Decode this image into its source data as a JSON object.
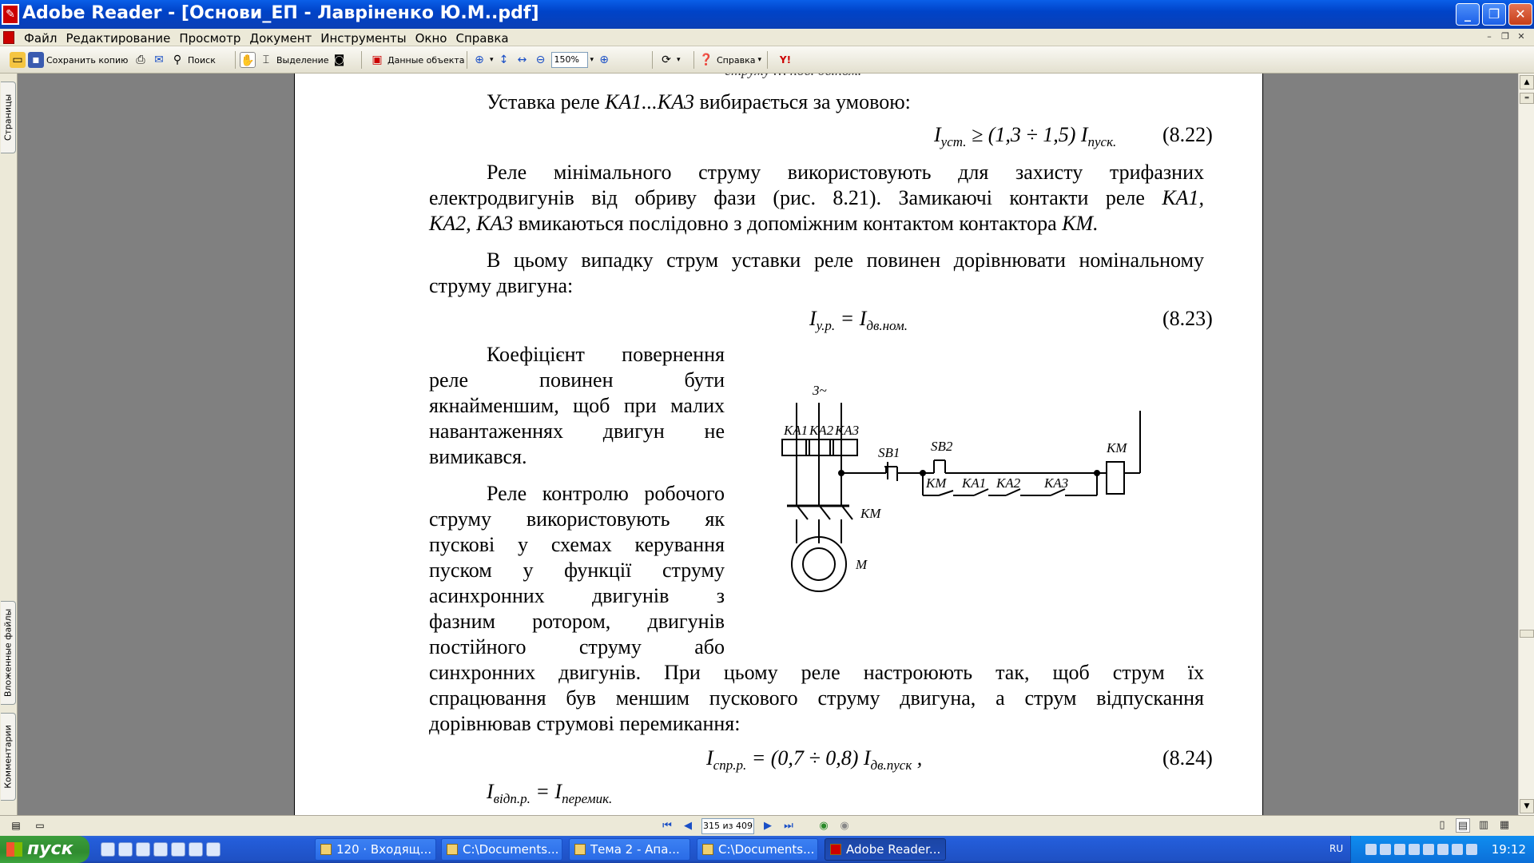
{
  "window": {
    "title": "Adobe Reader - [Основи_ЕП - Лавріненко Ю.М..pdf]",
    "controls": [
      "minimize",
      "restore",
      "close"
    ]
  },
  "menu": {
    "items": [
      "Файл",
      "Редактирование",
      "Просмотр",
      "Документ",
      "Инструменты",
      "Окно",
      "Справка"
    ]
  },
  "toolbar": {
    "save_copy": "Сохранить копию",
    "search": "Поиск",
    "select": "Выделение",
    "data_objects": "Данные объекта",
    "zoom": "150%",
    "help": "Справка"
  },
  "side_tabs": {
    "pages": "Страницы",
    "attachments": "Вложенные файлы",
    "comments": "Комментарии"
  },
  "document": {
    "top_line": "струму … пов.   дв.ном.",
    "p1": "Уставка реле",
    "p1_italic": "КА1...КА3",
    "p1_end": "вибирається за умовою:",
    "f822": {
      "lhs": "I",
      "lhs_sub": "уст.",
      "expr": " ≥ (1,3 ÷ 1,5) I",
      "rhs_sub": "пуск.",
      "num": "(8.22)"
    },
    "p2_line1": "Реле мінімального струму використовують для захисту трифазних",
    "p2_line2a": "електродвигунів від обриву фази  (рис. 8.21). Замикаючі контакти реле",
    "p2_line2b": "КА1,",
    "p2_line3a": "КА2, КА3",
    "p2_line3b": "вмикаються послідовно з допоміжним контактом контактора",
    "p2_line3c": "КМ.",
    "p3_line1": "В цьому випадку струм уставки реле повинен дорівнювати номінальному",
    "p3_line2": "струму двигуна:",
    "f823": {
      "lhs": "I",
      "lhs_sub": "у.р.",
      "eq": " = I",
      "rhs_sub": "дв.ном.",
      "num": "(8.23)"
    },
    "p4": [
      "Коефіцієнт повернення",
      "реле повинен бути",
      "якнайменшим, щоб при малих",
      "навантаженнях двигун не",
      "вимикався."
    ],
    "p5": [
      "Реле контролю робочого",
      "струму використовують як",
      "пускові у схемах керування",
      "пуском у функції струму",
      "асинхронних двигунів з",
      "фазним ротором, двигунів",
      "постійного струму або"
    ],
    "p5_line8": "синхронних двигунів. При цьому реле настроюють так, щоб струм їх",
    "p5_line9": "спрацювання був меншим пускового струму двигуна, а струм відпускання",
    "p5_line10": "дорівнював струмові перемикання:",
    "f824": {
      "lhs": "I",
      "lhs_sub": "спр.р.",
      "expr": " = (0,7 ÷ 0,8) I",
      "rhs_sub": "дв.пуск",
      "tail": " ,",
      "num": "(8.24)"
    },
    "f825": {
      "lhs": "I",
      "lhs_sub": "відп.р.",
      "eq": " = I",
      "rhs_sub": "перемик."
    }
  },
  "diagram": {
    "supply": "3~",
    "relays": [
      "КА1",
      "КА2",
      "КА3"
    ],
    "buttons": [
      "SB1",
      "SB2"
    ],
    "coil": "КМ",
    "contacts": [
      "КМ",
      "КА1",
      "КА2",
      "КА3"
    ],
    "main_contactor": "КМ",
    "motor": "М"
  },
  "status": {
    "page_display": "315 из 409"
  },
  "taskbar": {
    "start": "пуск",
    "tasks": [
      "120 · Входящ...",
      "C:\\Documents...",
      "Тема 2 - Апа...",
      "C:\\Documents...",
      "Adobe Reader..."
    ],
    "lang": "RU",
    "clock": "19:12"
  }
}
